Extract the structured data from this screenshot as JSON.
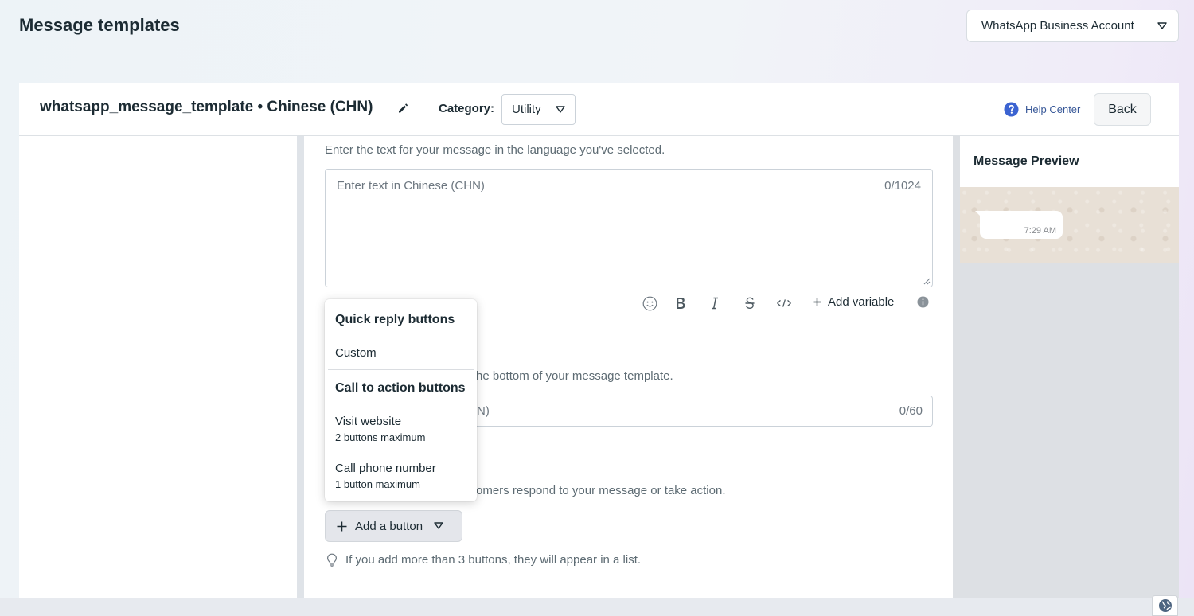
{
  "page": {
    "title": "Message templates",
    "account_selector": "WhatsApp Business Account"
  },
  "header": {
    "template_name": "whatsapp_message_template • Chinese (CHN)",
    "category_label": "Category",
    "category_value": "Utility",
    "help_center": "Help Center",
    "back": "Back"
  },
  "body_section": {
    "hint": "Enter the text for your message in the language you've selected.",
    "placeholder": "Enter text in Chinese (CHN)",
    "char_count": "0/1024",
    "toolbar": {
      "icons": [
        "emoji-icon",
        "bold-icon",
        "italic-icon",
        "strikethrough-icon",
        "code-icon"
      ],
      "add_variable": "Add variable"
    }
  },
  "footer_section": {
    "hint_visible": "he bottom of your message template.",
    "placeholder_visible": "N)",
    "char_count": "0/60"
  },
  "buttons_section": {
    "hint_visible": "omers respond to your message or take action.",
    "add_button": "Add a button",
    "tip": "If you add more than 3 buttons, they will appear in a list."
  },
  "dropdown": {
    "quick_reply_heading": "Quick reply buttons",
    "custom": "Custom",
    "cta_heading": "Call to action buttons",
    "visit_website": "Visit website",
    "visit_website_sub": "2 buttons maximum",
    "call_phone": "Call phone number",
    "call_phone_sub": "1 button maximum"
  },
  "preview": {
    "title": "Message Preview",
    "time": "7:29 AM"
  },
  "colors": {
    "link": "#385898",
    "help_icon": "#3b63d1",
    "text": "#1c2b33",
    "muted": "#5d6b73"
  }
}
